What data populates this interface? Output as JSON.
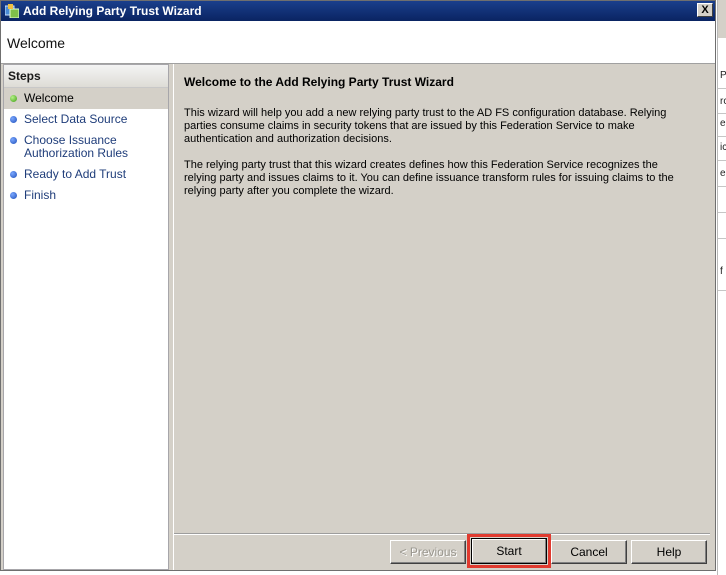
{
  "window": {
    "title": "Add Relying Party Trust Wizard",
    "close_label": "X"
  },
  "header": {
    "title": "Welcome"
  },
  "steps": {
    "heading": "Steps",
    "items": [
      {
        "label": "Welcome",
        "active": true
      },
      {
        "label": "Select Data Source",
        "active": false
      },
      {
        "label": "Choose Issuance Authorization Rules",
        "active": false
      },
      {
        "label": "Ready to Add Trust",
        "active": false
      },
      {
        "label": "Finish",
        "active": false
      }
    ]
  },
  "main": {
    "heading": "Welcome to the Add Relying Party Trust Wizard",
    "paragraph1": "This wizard will help you add a new relying party trust to the AD FS configuration database.  Relying parties consume claims in security tokens that are issued by this Federation Service to make authentication and authorization decisions.",
    "paragraph2": "The relying party trust that this wizard creates defines how this Federation Service recognizes the relying party and issues claims to it. You can define issuance transform rules for issuing claims to the relying party after you complete the wizard."
  },
  "buttons": {
    "previous": "< Previous",
    "start": "Start",
    "cancel": "Cancel",
    "help": "Help"
  },
  "colors": {
    "titlebar": "#0a2462",
    "highlight_box": "#e03a2f",
    "dialog_face": "#d4d0c8"
  },
  "background_window": {
    "chars": [
      "P",
      "rc",
      "e",
      "ic",
      "e",
      "",
      "",
      "f"
    ]
  }
}
